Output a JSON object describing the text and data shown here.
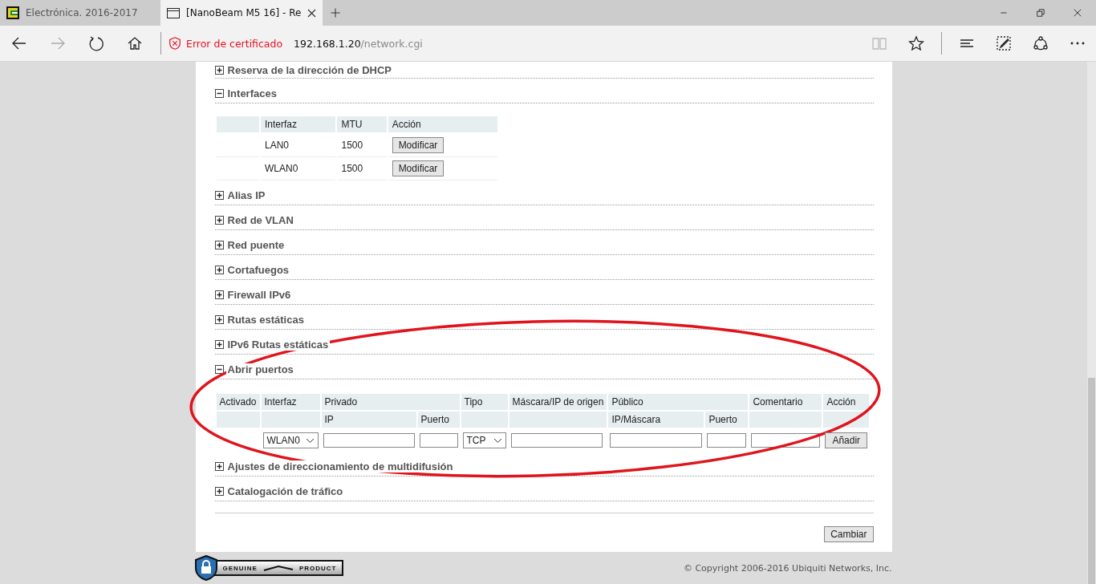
{
  "browser": {
    "tabs": [
      {
        "label": "Electrónica. 2016-2017",
        "selected": false,
        "kind": "site"
      },
      {
        "label": "[NanoBeam M5 16] - Re",
        "selected": true,
        "kind": "page"
      }
    ],
    "address": {
      "cert_error": "Error de certificado",
      "host": "192.168.1.20",
      "path": "/network.cgi"
    }
  },
  "sections": [
    {
      "title": "Reserva de la dirección de DHCP",
      "expanded": false
    },
    {
      "title": "Interfaces",
      "expanded": true,
      "kind": "interfaces",
      "table": {
        "columns": [
          "Interfaz",
          "MTU",
          "Acción"
        ],
        "rows": [
          {
            "interface": "LAN0",
            "mtu": "1500",
            "action": "Modificar"
          },
          {
            "interface": "WLAN0",
            "mtu": "1500",
            "action": "Modificar"
          }
        ]
      }
    },
    {
      "title": "Alias IP",
      "expanded": false
    },
    {
      "title": "Red de VLAN",
      "expanded": false
    },
    {
      "title": "Red puente",
      "expanded": false
    },
    {
      "title": "Cortafuegos",
      "expanded": false
    },
    {
      "title": "Firewall IPv6",
      "expanded": false
    },
    {
      "title": "Rutas estáticas",
      "expanded": false
    },
    {
      "title": "IPv6 Rutas estáticas",
      "expanded": false
    },
    {
      "title": "Abrir puertos",
      "expanded": true,
      "kind": "ports",
      "table": {
        "columns": [
          "Activado",
          "Interfaz",
          "Privado",
          "Tipo",
          "Máscara/IP de origen",
          "Público",
          "Comentario",
          "Acción"
        ],
        "subcolumns": [
          "IP",
          "Puerto",
          "IP/Máscara",
          "Puerto"
        ],
        "interface": "WLAN0",
        "type": "TCP",
        "add_button": "Añadir"
      }
    },
    {
      "title": "Ajustes de direccionamiento de multidifusión",
      "expanded": false
    },
    {
      "title": "Catalogación de tráfico",
      "expanded": false
    }
  ],
  "apply_button": "Cambiar",
  "footer": {
    "badge": [
      "GENUINE",
      "PRODUCT"
    ],
    "copyright": "© Copyright 2006-2016 Ubiquiti Networks, Inc."
  }
}
